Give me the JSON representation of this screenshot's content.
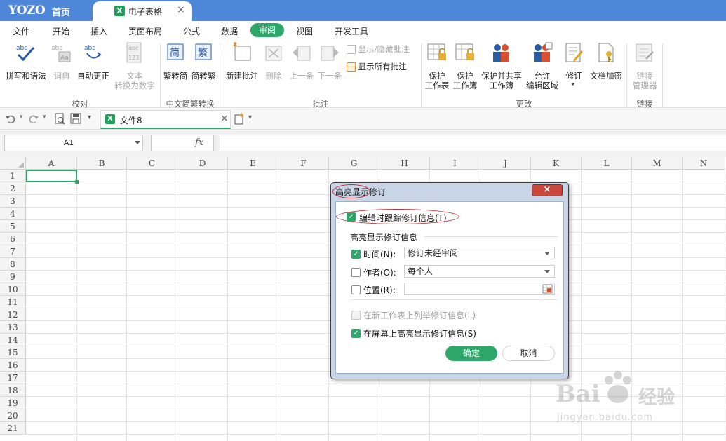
{
  "title_bar": {
    "logo": "YOZO",
    "home_tab": "首页",
    "doc_tab": "电子表格",
    "doc_tab_icon": "X",
    "close_glyph": "×"
  },
  "menu": {
    "items": [
      "文件",
      "开始",
      "插入",
      "页面布局",
      "公式",
      "数据",
      "审阅",
      "视图",
      "开发工具"
    ],
    "active": "审阅"
  },
  "ribbon": {
    "proofing": {
      "spell": "拼写和语法",
      "dict": "词典",
      "autocorrect": "自动更正",
      "text_to_num_1": "文本",
      "text_to_num_2": "转换为数字",
      "group": "校对"
    },
    "chinese": {
      "to_trad": "繁转简",
      "to_simp": "简转繁",
      "group": "中文简繁转换"
    },
    "comments": {
      "new": "新建批注",
      "delete": "删除",
      "prev": "上一条",
      "next": "下一条",
      "show_hide": "显示/隐藏批注",
      "show_all": "显示所有批注",
      "group": "批注"
    },
    "changes": {
      "protect_sheet_1": "保护",
      "protect_sheet_2": "工作表",
      "protect_book_1": "保护",
      "protect_book_2": "工作簿",
      "protect_share_1": "保护并共享",
      "protect_share_2": "工作簿",
      "allow_edit_1": "允许",
      "allow_edit_2": "编辑区域",
      "track": "修订",
      "encrypt": "文档加密",
      "group": "更改"
    },
    "links": {
      "manager_1": "链接",
      "manager_2": "管理器",
      "group": "链接"
    }
  },
  "quick_bar": {
    "file_tab": "文件8",
    "file_icon": "X",
    "close_glyph": "×"
  },
  "formula_bar": {
    "name_box": "A1",
    "fx": "fx",
    "value": ""
  },
  "grid": {
    "columns": [
      "A",
      "B",
      "C",
      "D",
      "E",
      "F",
      "G",
      "H",
      "I",
      "J",
      "K",
      "L",
      "M",
      "N"
    ],
    "rows": [
      "1",
      "2",
      "3",
      "4",
      "5",
      "6",
      "7",
      "8",
      "9",
      "10",
      "11",
      "12",
      "13",
      "14",
      "15",
      "16",
      "17",
      "18",
      "19",
      "20",
      "21"
    ],
    "selected_cell": "A1"
  },
  "dialog": {
    "title": "高亮显示修订",
    "track_label": "编辑时跟踪修订信息(T)",
    "track_checked": true,
    "section": "高亮显示修订信息",
    "when_label": "时间(N):",
    "when_checked": true,
    "when_value": "修订未经审阅",
    "who_label": "作者(O):",
    "who_checked": false,
    "who_value": "每个人",
    "where_label": "位置(R):",
    "where_checked": false,
    "where_value": "",
    "list_label": "在新工作表上列举修订信息(L)",
    "list_checked": false,
    "screen_label": "在屏幕上高亮显示修订信息(S)",
    "screen_checked": true,
    "ok": "确定",
    "cancel": "取消",
    "close": "×"
  },
  "watermark": {
    "brand": "Bai",
    "brand_cn": "经验",
    "url": "jingyan.baidu.com"
  },
  "colors": {
    "title_bar": "#4e86d8",
    "accent_green": "#2ea86a",
    "annotation_red": "#c0262f",
    "close_red": "#c9463d"
  }
}
